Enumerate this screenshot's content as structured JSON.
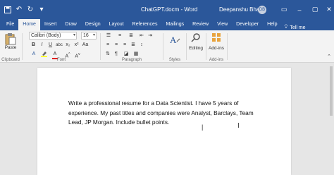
{
  "window": {
    "doc_title": "ChatGPT.docm - Word",
    "user_name": "Deepanshu Bhalla",
    "avatar_initials": "DB"
  },
  "tabs": [
    "File",
    "Home",
    "Insert",
    "Draw",
    "Design",
    "Layout",
    "References",
    "Mailings",
    "Review",
    "View",
    "Developer",
    "Help"
  ],
  "tell_me": "Tell me",
  "ribbon": {
    "paste_label": "Paste",
    "font_name": "Calibri (Body)",
    "font_size": "16",
    "editing_label": "Editing",
    "addins_label": "Add-ins",
    "groups": {
      "clipboard": "Clipboard",
      "font": "Font",
      "paragraph": "Paragraph",
      "styles": "Styles",
      "addins": "Add-ins"
    }
  },
  "document": {
    "body": "Write a professional resume for a Data Scientist. I have 5 years of experience. My past titles and companies were Analyst, Barclays, Team Lead, JP Morgan. Include bullet points."
  },
  "colors": {
    "title_bar": "#2b579a",
    "ribbon_bg": "#f3f3f3",
    "workspace": "#e6e6e6"
  }
}
